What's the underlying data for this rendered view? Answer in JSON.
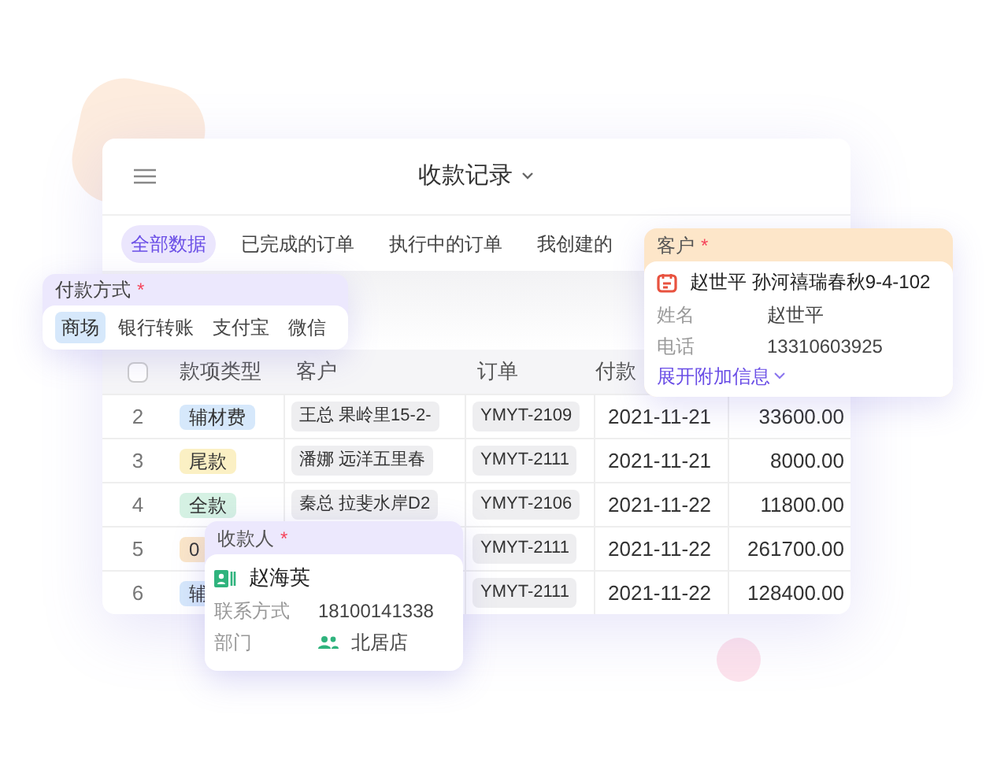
{
  "window": {
    "title": "收款记录"
  },
  "tabs": [
    {
      "label": "全部数据",
      "selected": true
    },
    {
      "label": "已完成的订单",
      "selected": false
    },
    {
      "label": "执行中的订单",
      "selected": false
    },
    {
      "label": "我创建的",
      "selected": false
    }
  ],
  "table": {
    "select_all": {
      "checked": false
    },
    "columns": [
      "款项类型",
      "客户",
      "订单",
      "付款"
    ],
    "rows": [
      {
        "index": "2",
        "type": "辅材费",
        "color": "#d6e8fb",
        "customer": "王总 果岭里15-2-",
        "order": "YMYT-2109",
        "date": "2021-11-21",
        "amount": "33600.00"
      },
      {
        "index": "3",
        "type": "尾款",
        "color": "#fbf0c4",
        "customer": "潘娜 远洋五里春",
        "order": "YMYT-2111",
        "date": "2021-11-21",
        "amount": "8000.00"
      },
      {
        "index": "4",
        "type": "全款",
        "color": "#d5f1e3",
        "customer": "秦总 拉斐水岸D2",
        "order": "YMYT-2106",
        "date": "2021-11-22",
        "amount": "11800.00"
      },
      {
        "index": "5",
        "type": "0",
        "color": "#fbe6c8",
        "order": "YMYT-2111",
        "date": "2021-11-22",
        "amount": "261700.00"
      },
      {
        "index": "6",
        "type": "辅",
        "color": "#d6e8fb",
        "order": "YMYT-2111",
        "date": "2021-11-22",
        "amount": "128400.00"
      }
    ]
  },
  "payment_method": {
    "label": "付款方式",
    "required_mark": "*",
    "options": [
      {
        "label": "商场",
        "selected": true
      },
      {
        "label": "银行转账",
        "selected": false
      },
      {
        "label": "支付宝",
        "selected": false
      },
      {
        "label": "微信",
        "selected": false
      }
    ]
  },
  "customer": {
    "label": "客户",
    "required_mark": "*",
    "title": "赵世平 孙河禧瑞春秋9-4-102",
    "fields": [
      {
        "label": "姓名",
        "value": "赵世平"
      },
      {
        "label": "电话",
        "value": "13310603925"
      }
    ],
    "link": "展开附加信息"
  },
  "payee": {
    "label": "收款人",
    "required_mark": "*",
    "name": "赵海英",
    "fields": [
      {
        "label": "联系方式",
        "value": "18100141338",
        "kind": "text"
      },
      {
        "label": "部门",
        "value": "北居店",
        "kind": "group"
      }
    ]
  }
}
